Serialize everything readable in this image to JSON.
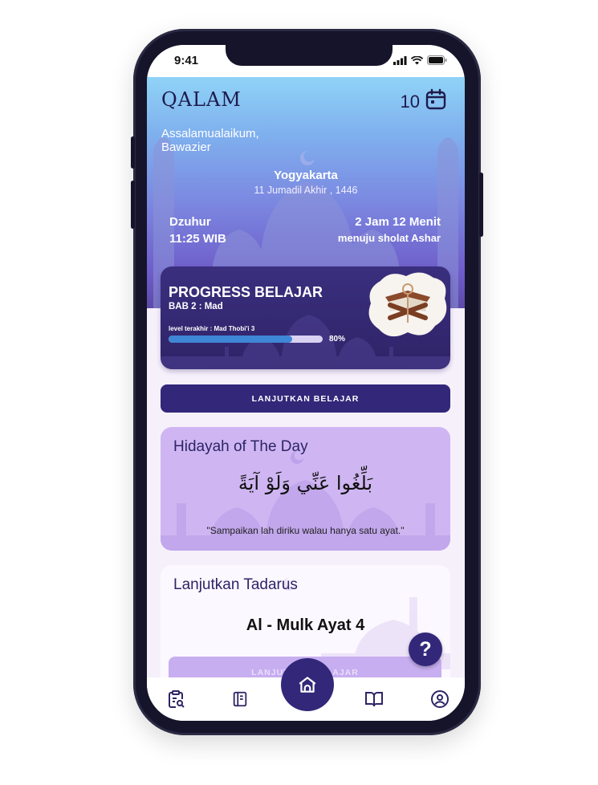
{
  "status_bar": {
    "time": "9:41"
  },
  "header": {
    "brand": "QALAM",
    "date_number": "10"
  },
  "greeting": {
    "salutation": "Assalamualaikum,",
    "name": "Bawazier"
  },
  "location": {
    "city": "Yogyakarta",
    "hijri_date": "11 Jumadil Akhir , 1446"
  },
  "prayer": {
    "current_name": "Dzuhur",
    "current_time": "11:25 WIB",
    "countdown": "2 Jam 12 Menit",
    "countdown_label": "menuju sholat Ashar"
  },
  "progress": {
    "title": "PROGRESS BELAJAR",
    "chapter": "BAB 2 : Mad",
    "last_level": "level terakhir : Mad Thobi'i 3",
    "percent_label": "80%",
    "percent": 0.8
  },
  "continue_button": "LANJUTKAN BELAJAR",
  "hidayah": {
    "title": "Hidayah of The Day",
    "arabic": "بَلِّغُوا عَنِّي وَلَوْ آيَةً",
    "translation": "\"Sampaikan lah diriku walau hanya satu ayat.\""
  },
  "tadarus": {
    "title": "Lanjutkan Tadarus",
    "surah": "Al - Mulk Ayat 4",
    "button": "LANJUTKAN BELAJAR"
  },
  "help_button": "?",
  "nav": {
    "items": [
      "clipboard-search-icon",
      "notebook-icon",
      "home-icon",
      "book-open-icon",
      "user-circle-icon"
    ]
  },
  "colors": {
    "primary": "#33277a",
    "card_purple": "#cfb6f2",
    "progress_fill": "#3f86d6"
  }
}
